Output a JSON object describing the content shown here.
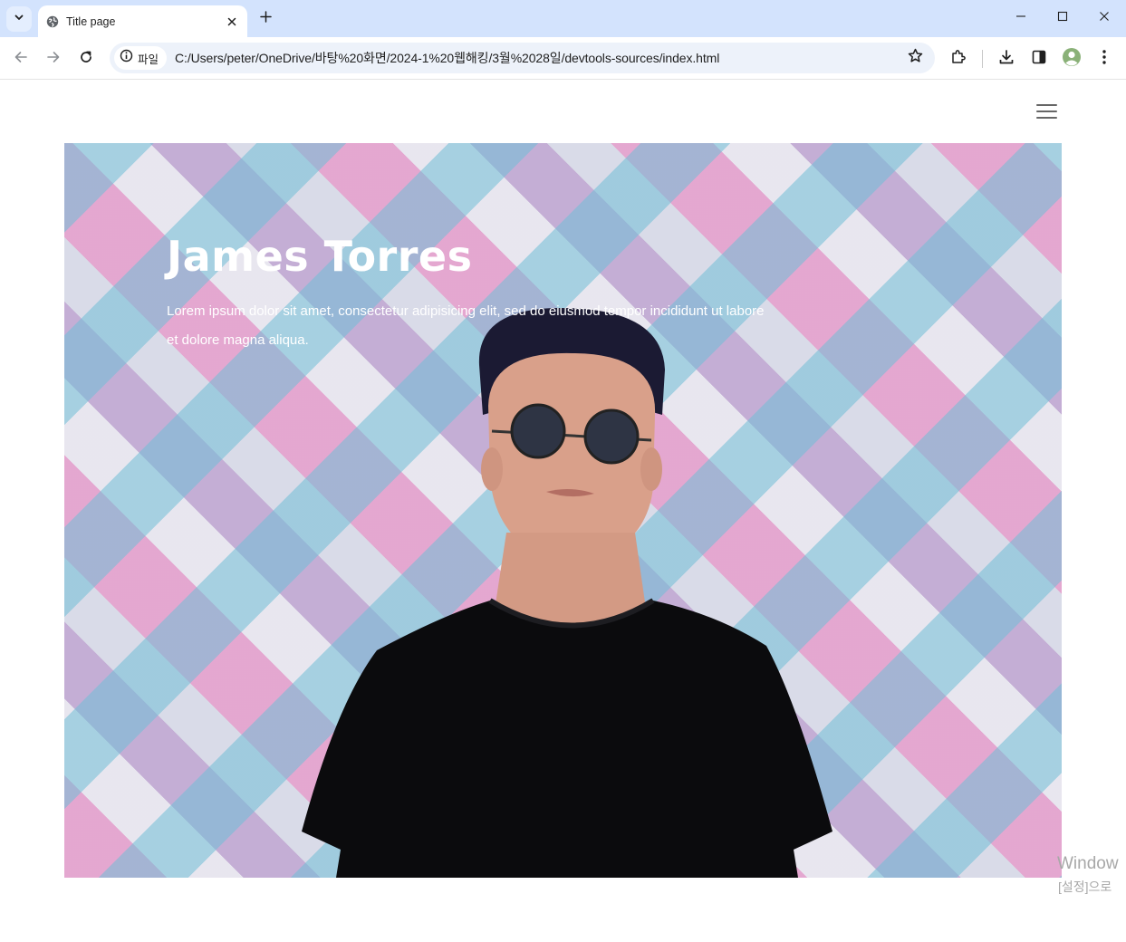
{
  "browser": {
    "tab_title": "Title page",
    "site_chip_label": "파일",
    "url": "C:/Users/peter/OneDrive/바탕%20화면/2024-1%20웹해킹/3월%2028일/devtools-sources/index.html",
    "icons": {
      "tab_search": "chevron-down-icon",
      "favicon": "globe-icon",
      "tab_close": "close-icon",
      "new_tab": "plus-icon",
      "minimize": "minimize-icon",
      "maximize": "maximize-icon",
      "close_window": "close-icon",
      "back": "back-arrow-icon",
      "forward": "forward-arrow-icon",
      "reload": "reload-icon",
      "site_info": "info-icon",
      "bookmark": "star-icon",
      "extensions": "puzzle-icon",
      "downloads": "download-icon",
      "side_panel": "side-panel-icon",
      "profile": "avatar-icon",
      "menu": "kebab-menu-icon"
    }
  },
  "page": {
    "menu_icon": "hamburger-icon",
    "hero": {
      "name": "James Torres",
      "text": "Lorem ipsum dolor sit amet, consectetur adipisicing elit, sed do eiusmod tempor incididunt ut labore et dolore magna aliqua."
    }
  },
  "overlay": {
    "watermark_line1": "Window",
    "watermark_line2": "[설정]으로"
  },
  "colors": {
    "tabbar_bg": "#d3e3fd",
    "omnibox_bg": "#edf2fa",
    "hero_text": "#ffffff"
  }
}
